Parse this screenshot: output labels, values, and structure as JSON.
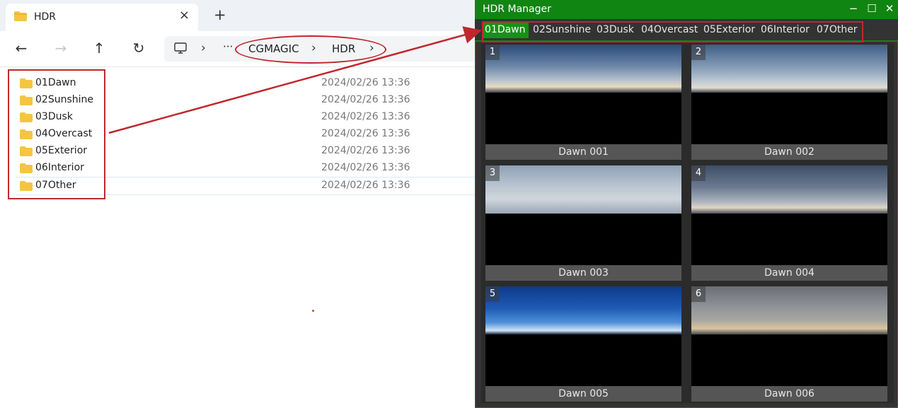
{
  "explorer": {
    "tab": {
      "title": "HDR",
      "close_icon": "×",
      "new_tab_icon": "+"
    },
    "nav": {
      "back": "←",
      "forward": "→",
      "up": "↑",
      "refresh": "↻",
      "more": "···"
    },
    "breadcrumb": [
      "CGMAGIC",
      "HDR"
    ],
    "files": [
      {
        "name": "01Dawn",
        "date": "2024/02/26 13:36"
      },
      {
        "name": "02Sunshine",
        "date": "2024/02/26 13:36"
      },
      {
        "name": "03Dusk",
        "date": "2024/02/26 13:36"
      },
      {
        "name": "04Overcast",
        "date": "2024/02/26 13:36"
      },
      {
        "name": "05Exterior",
        "date": "2024/02/26 13:36"
      },
      {
        "name": "06Interior",
        "date": "2024/02/26 13:36"
      },
      {
        "name": "07Other",
        "date": "2024/02/26 13:36"
      }
    ]
  },
  "hdr_manager": {
    "title": "HDR Manager",
    "controls": {
      "minimize": "−",
      "maximize": "☐",
      "close": "✕"
    },
    "tabs": [
      "01Dawn",
      "02Sunshine",
      "03Dusk",
      "04Overcast",
      "05Exterior",
      "06Interior",
      "07Other"
    ],
    "active_tab": "01Dawn",
    "items": [
      {
        "num": "1",
        "label": "Dawn 001"
      },
      {
        "num": "2",
        "label": "Dawn 002"
      },
      {
        "num": "3",
        "label": "Dawn 003"
      },
      {
        "num": "4",
        "label": "Dawn 004"
      },
      {
        "num": "5",
        "label": "Dawn 005"
      },
      {
        "num": "6",
        "label": "Dawn 006"
      }
    ]
  },
  "colors": {
    "annotation_red": "#c0272d",
    "manager_green": "#118511",
    "folder_yellow": "#f5c542"
  }
}
